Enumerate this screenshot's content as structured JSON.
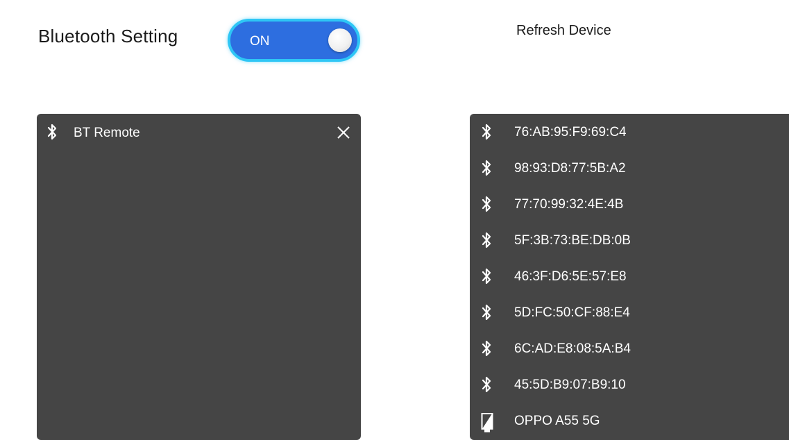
{
  "header": {
    "title": "Bluetooth Setting",
    "toggle_label": "ON",
    "refresh_label": "Refresh Device"
  },
  "paired": {
    "items": [
      {
        "name": "BT Remote",
        "icon": "bluetooth-icon"
      }
    ],
    "remove_icon": "close-icon"
  },
  "available": {
    "items": [
      {
        "name": "76:AB:95:F9:69:C4",
        "icon": "bluetooth-icon"
      },
      {
        "name": "98:93:D8:77:5B:A2",
        "icon": "bluetooth-icon"
      },
      {
        "name": "77:70:99:32:4E:4B",
        "icon": "bluetooth-icon"
      },
      {
        "name": "5F:3B:73:BE:DB:0B",
        "icon": "bluetooth-icon"
      },
      {
        "name": "46:3F:D6:5E:57:E8",
        "icon": "bluetooth-icon"
      },
      {
        "name": "5D:FC:50:CF:88:E4",
        "icon": "bluetooth-icon"
      },
      {
        "name": "6C:AD:E8:08:5A:B4",
        "icon": "bluetooth-icon"
      },
      {
        "name": "45:5D:B9:07:B9:10",
        "icon": "bluetooth-icon"
      },
      {
        "name": "OPPO A55 5G",
        "icon": "phone-icon"
      }
    ]
  },
  "colors": {
    "toggle_fill": "#2d6ee0",
    "toggle_border": "#2ec6f5",
    "panel_background": "#454545",
    "text_light": "#ffffff"
  }
}
